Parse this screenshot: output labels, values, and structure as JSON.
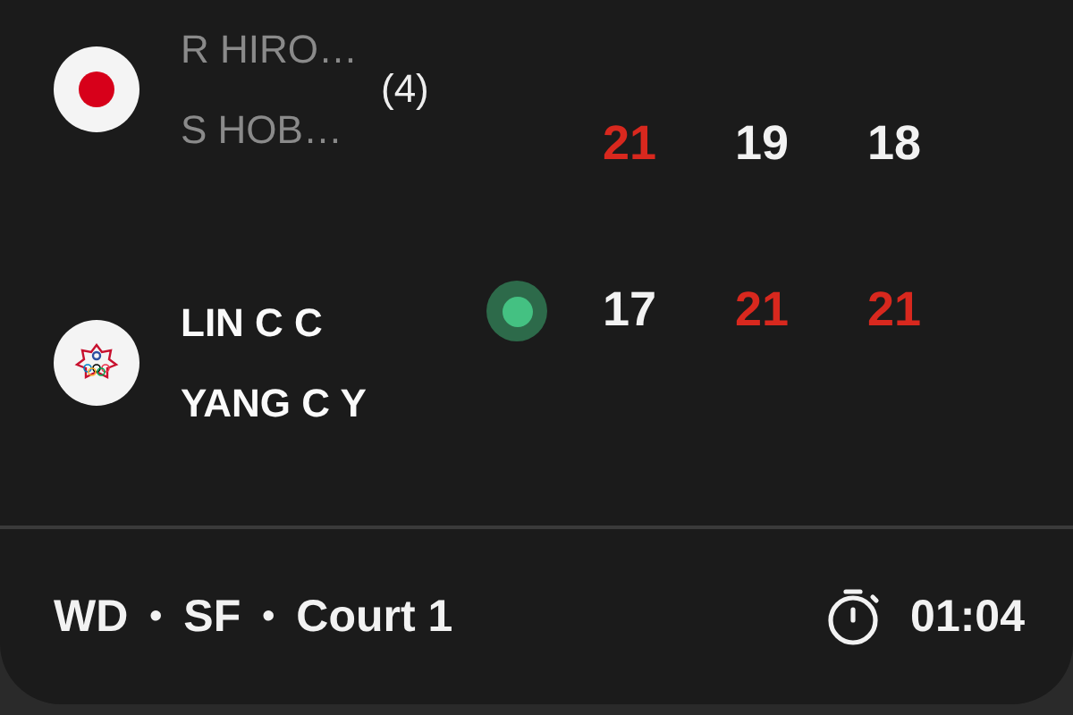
{
  "teams": [
    {
      "flag": {
        "kind": "japan"
      },
      "players": [
        "R HIRO…",
        "S HOB…"
      ],
      "seed": "(4)",
      "winner": false,
      "serving": false,
      "scores": [
        {
          "value": "21",
          "won": true
        },
        {
          "value": "19",
          "won": false
        },
        {
          "value": "18",
          "won": false
        }
      ]
    },
    {
      "flag": {
        "kind": "chinese-taipei"
      },
      "players": [
        "LIN C C",
        "YANG C Y"
      ],
      "winner": true,
      "serving": true,
      "scores": [
        {
          "value": "17",
          "won": false
        },
        {
          "value": "21",
          "won": true
        },
        {
          "value": "21",
          "won": true
        }
      ]
    }
  ],
  "footer": {
    "event": "WD",
    "round": "SF",
    "court": "Court 1",
    "separator": "•",
    "duration": "01:04"
  }
}
